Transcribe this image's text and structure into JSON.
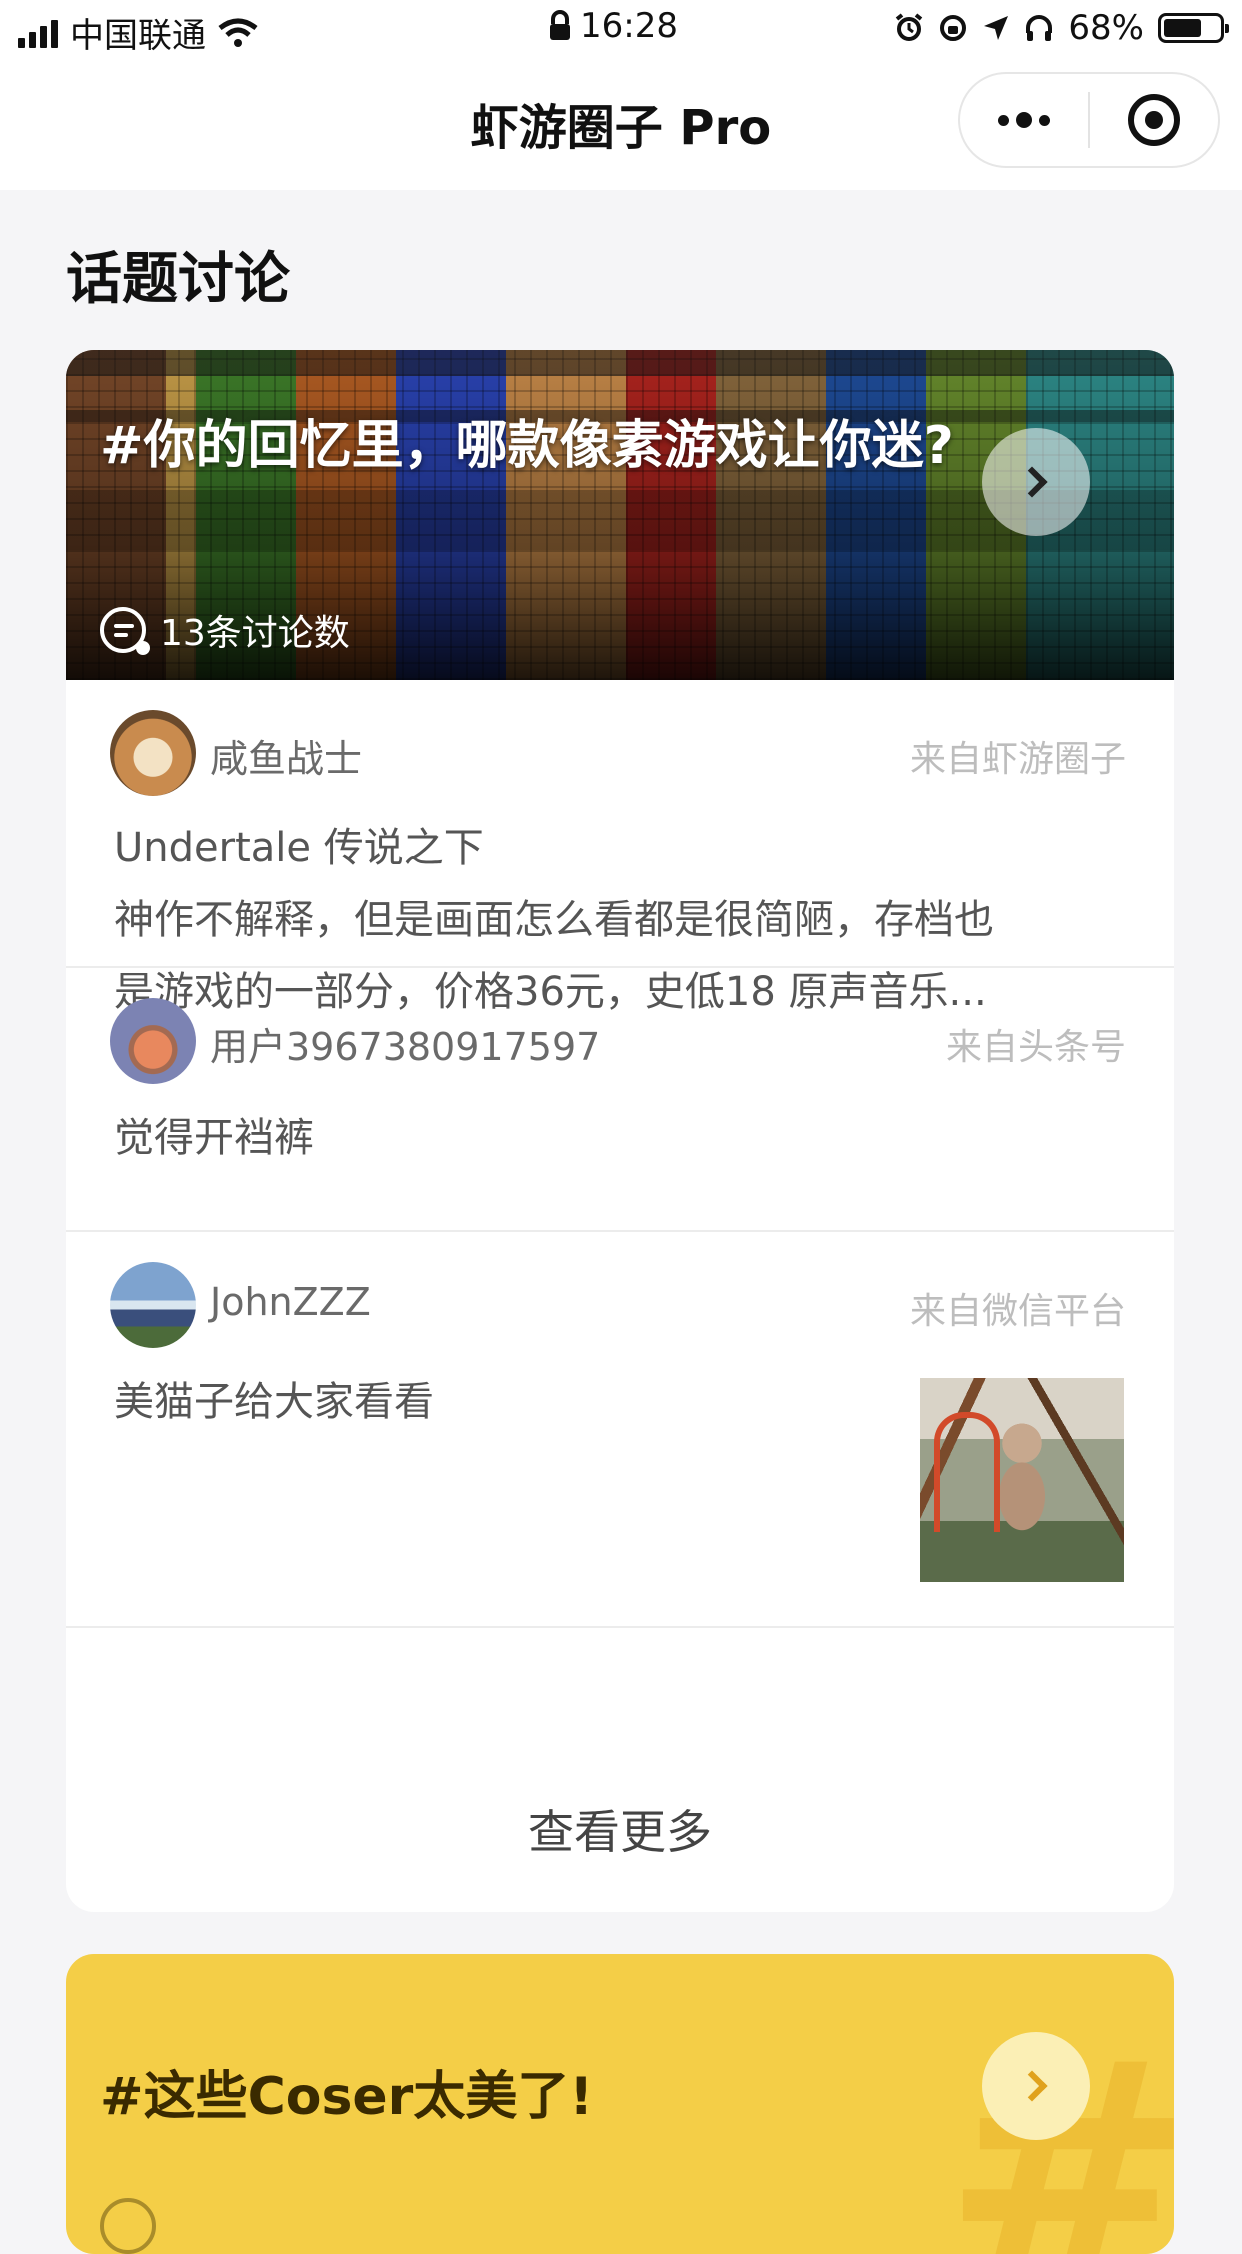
{
  "status_bar": {
    "carrier": "中国联通",
    "time": "16:28",
    "battery_percent": "68%",
    "battery_level": 0.68,
    "icons": [
      "signal-icon",
      "wifi-icon",
      "lock-icon",
      "alarm-icon",
      "rotation-lock-icon",
      "location-icon",
      "headphones-icon",
      "battery-icon"
    ]
  },
  "nav": {
    "title": "虾游圈子 Pro",
    "icons": [
      "more-icon",
      "close-target-icon"
    ]
  },
  "section": {
    "title": "话题讨论"
  },
  "topic": {
    "title": "#你的回忆里，哪款像素游戏让你迷?",
    "count": "13条讨论数"
  },
  "posts": [
    {
      "user": "咸鱼战士",
      "source": "来自虾游圈子",
      "text_lines": [
        "Undertale 传说之下",
        "神作不解释，但是画面怎么看都是很简陋，存档也",
        "是游戏的一部分，价格36元，史低18 原声音乐..."
      ]
    },
    {
      "user": "用户3967380917597",
      "source": "来自头条号",
      "text_lines": [
        "觉得开裆裤"
      ]
    },
    {
      "user": "JohnZZZ",
      "source": "来自微信平台",
      "text_lines": [
        "美猫子给大家看看"
      ]
    }
  ],
  "more_label": "查看更多",
  "next_topic": {
    "title": "#这些Coser太美了!"
  },
  "colors": {
    "accent_yellow": "#f4ce47",
    "background": "#f5f5f7",
    "source_gray": "#bdbdbd"
  }
}
